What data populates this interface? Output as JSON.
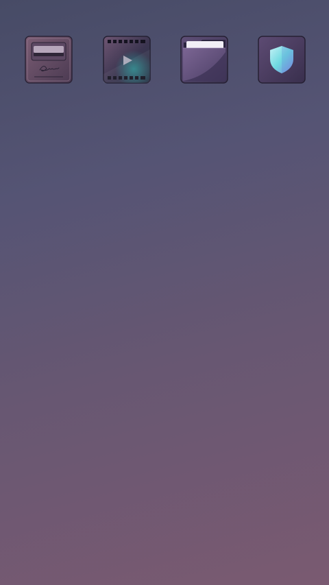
{
  "home_screen": {
    "wallpaper_colors": [
      "#474b66",
      "#555474",
      "#675772",
      "#7a5a71"
    ],
    "apps": [
      {
        "id": "email",
        "icon": "mailbox-icon",
        "label": "",
        "signature_text": "Email"
      },
      {
        "id": "video",
        "icon": "film-play-icon",
        "label": ""
      },
      {
        "id": "files",
        "icon": "folder-icon",
        "label": ""
      },
      {
        "id": "security",
        "icon": "shield-icon",
        "label": "",
        "accent": "#8ee6e0"
      }
    ]
  }
}
